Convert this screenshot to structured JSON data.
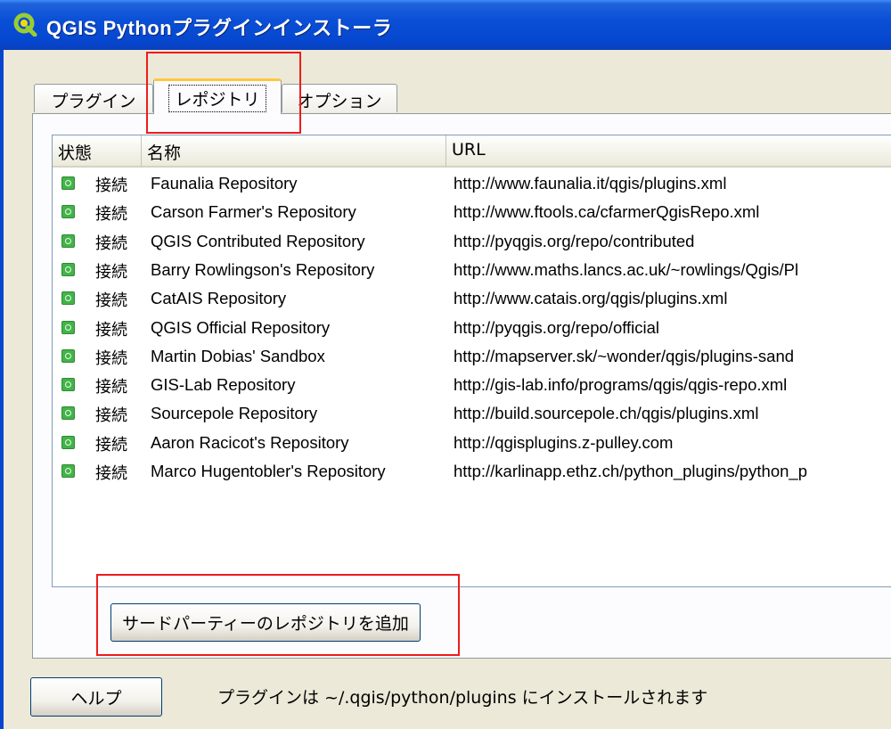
{
  "window": {
    "title": "QGIS Pythonプラグインインストーラ",
    "icon": "qgis-icon"
  },
  "tabs": [
    {
      "label": "プラグイン",
      "active": false
    },
    {
      "label": "レポジトリ",
      "active": true
    },
    {
      "label": "オプション",
      "active": false
    }
  ],
  "table": {
    "headers": {
      "status": "状態",
      "name": "名称",
      "url": "URL"
    },
    "rows": [
      {
        "status": "接続",
        "name": "Faunalia Repository",
        "url": "http://www.faunalia.it/qgis/plugins.xml"
      },
      {
        "status": "接続",
        "name": "Carson Farmer's Repository",
        "url": "http://www.ftools.ca/cfarmerQgisRepo.xml"
      },
      {
        "status": "接続",
        "name": "QGIS Contributed Repository",
        "url": "http://pyqgis.org/repo/contributed"
      },
      {
        "status": "接続",
        "name": "Barry Rowlingson's Repository",
        "url": "http://www.maths.lancs.ac.uk/~rowlings/Qgis/Pl"
      },
      {
        "status": "接続",
        "name": "CatAIS Repository",
        "url": "http://www.catais.org/qgis/plugins.xml"
      },
      {
        "status": "接続",
        "name": "QGIS Official Repository",
        "url": "http://pyqgis.org/repo/official"
      },
      {
        "status": "接続",
        "name": "Martin Dobias' Sandbox",
        "url": "http://mapserver.sk/~wonder/qgis/plugins-sand"
      },
      {
        "status": "接続",
        "name": "GIS-Lab Repository",
        "url": "http://gis-lab.info/programs/qgis/qgis-repo.xml"
      },
      {
        "status": "接続",
        "name": "Sourcepole Repository",
        "url": "http://build.sourcepole.ch/qgis/plugins.xml"
      },
      {
        "status": "接続",
        "name": "Aaron Racicot's Repository",
        "url": "http://qgisplugins.z-pulley.com"
      },
      {
        "status": "接続",
        "name": "Marco Hugentobler's Repository",
        "url": "http://karlinapp.ethz.ch/python_plugins/python_p"
      }
    ]
  },
  "add_repo_button": "サードパーティーのレポジトリを追加",
  "help_button": "ヘルプ",
  "footer_text": "プラグインは ~/.qgis/python/plugins にインストールされます",
  "colors": {
    "title_bar": "#0646cf",
    "status_connected": "#44b34a",
    "annotation": "#ee1c1c"
  }
}
